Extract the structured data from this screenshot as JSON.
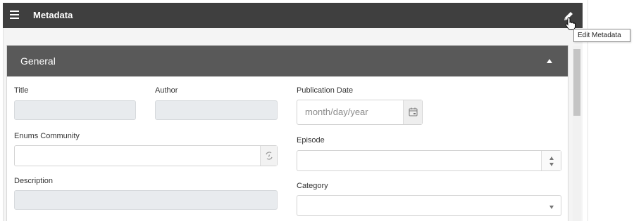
{
  "header": {
    "title": "Metadata",
    "menu_icon": "hamburger-menu-icon",
    "edit_icon": "pencil-icon",
    "edit_tooltip": "Edit Metadata"
  },
  "section": {
    "title": "General",
    "collapse_icon": "caret-up-icon"
  },
  "fields": {
    "title": {
      "label": "Title",
      "value": ""
    },
    "author": {
      "label": "Author",
      "value": ""
    },
    "publication_date": {
      "label": "Publication Date",
      "placeholder": "month/day/year",
      "icon": "calendar-icon"
    },
    "enums_community": {
      "label": "Enums Community",
      "value": "",
      "icon": "enum-lookup-icon"
    },
    "episode": {
      "label": "Episode",
      "value": ""
    },
    "description": {
      "label": "Description",
      "value": ""
    },
    "category": {
      "label": "Category",
      "value": ""
    }
  },
  "colors": {
    "topbar": "#3f3f3f",
    "section_header": "#595959",
    "disabled_field": "#e8ebee"
  }
}
